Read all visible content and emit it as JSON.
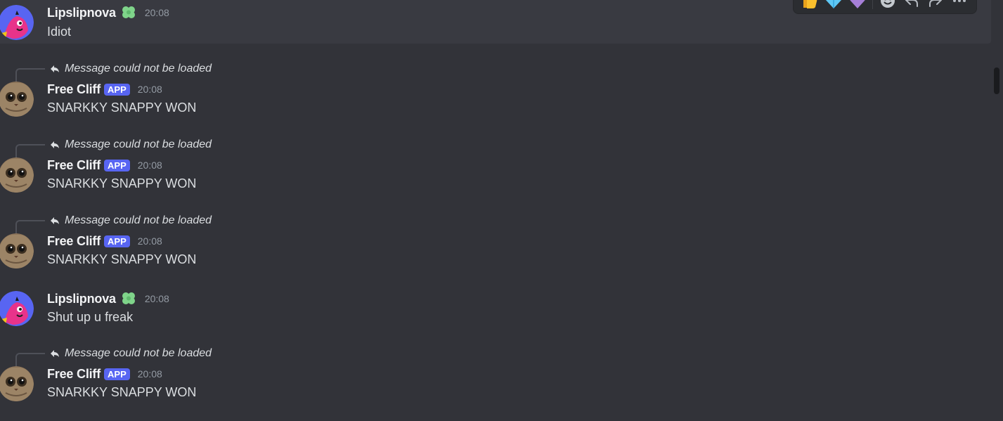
{
  "toolbar": {
    "reactions": [
      "thumbs-up",
      "gem",
      "purple-heart"
    ],
    "actions": [
      "add-reaction",
      "reply",
      "forward",
      "more"
    ]
  },
  "messages": [
    {
      "type": "plain",
      "username": "Lipslipnova",
      "time": "20:08",
      "text": "Idiot"
    },
    {
      "type": "reply",
      "reply_text": "Message could not be loaded",
      "username": "Free Cliff",
      "badge": "APP",
      "time": "20:08",
      "text": "SNARKKY SNAPPY WON"
    },
    {
      "type": "reply",
      "reply_text": "Message could not be loaded",
      "username": "Free Cliff",
      "badge": "APP",
      "time": "20:08",
      "text": "SNARKKY SNAPPY WON"
    },
    {
      "type": "reply",
      "reply_text": "Message could not be loaded",
      "username": "Free Cliff",
      "badge": "APP",
      "time": "20:08",
      "text": "SNARKKY SNAPPY WON"
    },
    {
      "type": "plain",
      "username": "Lipslipnova",
      "time": "20:08",
      "text": "Shut up u freak"
    },
    {
      "type": "reply",
      "reply_text": "Message could not be loaded",
      "username": "Free Cliff",
      "badge": "APP",
      "time": "20:08",
      "text": "SNARKKY SNAPPY WON"
    }
  ],
  "colors": {
    "background": "#323339",
    "hover": "#393a41",
    "app_badge": "#5865f2",
    "role_icon": "#7fd48a"
  }
}
